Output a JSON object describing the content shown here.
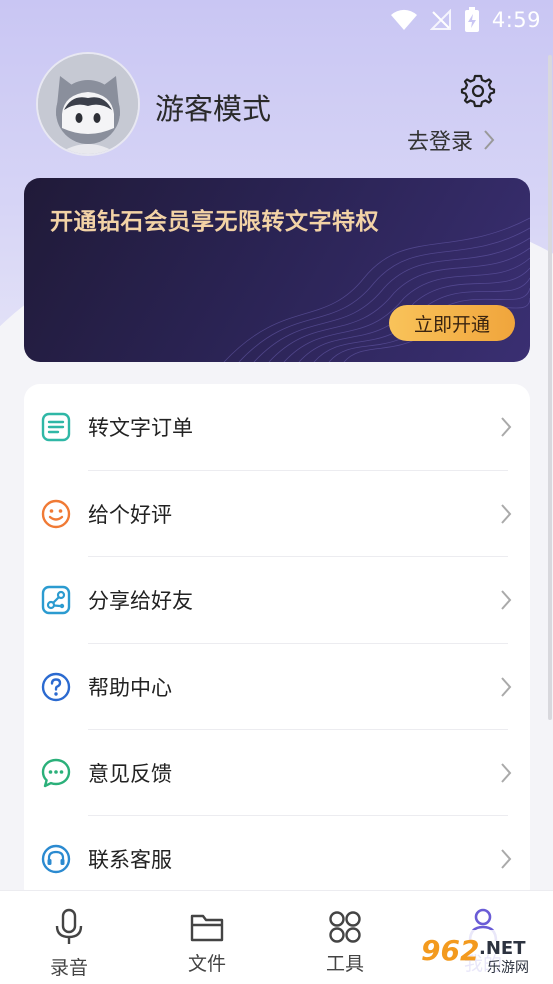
{
  "status_bar": {
    "time": "4:59"
  },
  "profile": {
    "username": "游客模式",
    "login_label": "去登录"
  },
  "vip": {
    "title": "开通钻石会员享无限转文字特权",
    "button": "立即开通"
  },
  "menu": [
    {
      "label": "转文字订单",
      "icon": "document-list-icon",
      "color": "#2fb7a6"
    },
    {
      "label": "给个好评",
      "icon": "smiley-icon",
      "color": "#f07a35"
    },
    {
      "label": "分享给好友",
      "icon": "share-icon",
      "color": "#2b9bd0"
    },
    {
      "label": "帮助中心",
      "icon": "help-icon",
      "color": "#2b6ad0"
    },
    {
      "label": "意见反馈",
      "icon": "feedback-icon",
      "color": "#2bb07a"
    },
    {
      "label": "联系客服",
      "icon": "headset-icon",
      "color": "#2b8ad0"
    }
  ],
  "nav": [
    {
      "label": "录音",
      "icon": "microphone-icon"
    },
    {
      "label": "文件",
      "icon": "folder-icon"
    },
    {
      "label": "工具",
      "icon": "tools-grid-icon"
    },
    {
      "label": "我的",
      "icon": "profile-icon",
      "active": true
    }
  ],
  "watermark": {
    "brand": "962",
    "net": ".NET",
    "subtitle": "乐游网"
  },
  "colors": {
    "accent": "#6a5cd6",
    "vip_gold": "#f3d3a6",
    "vip_button": "#f0a53c"
  }
}
